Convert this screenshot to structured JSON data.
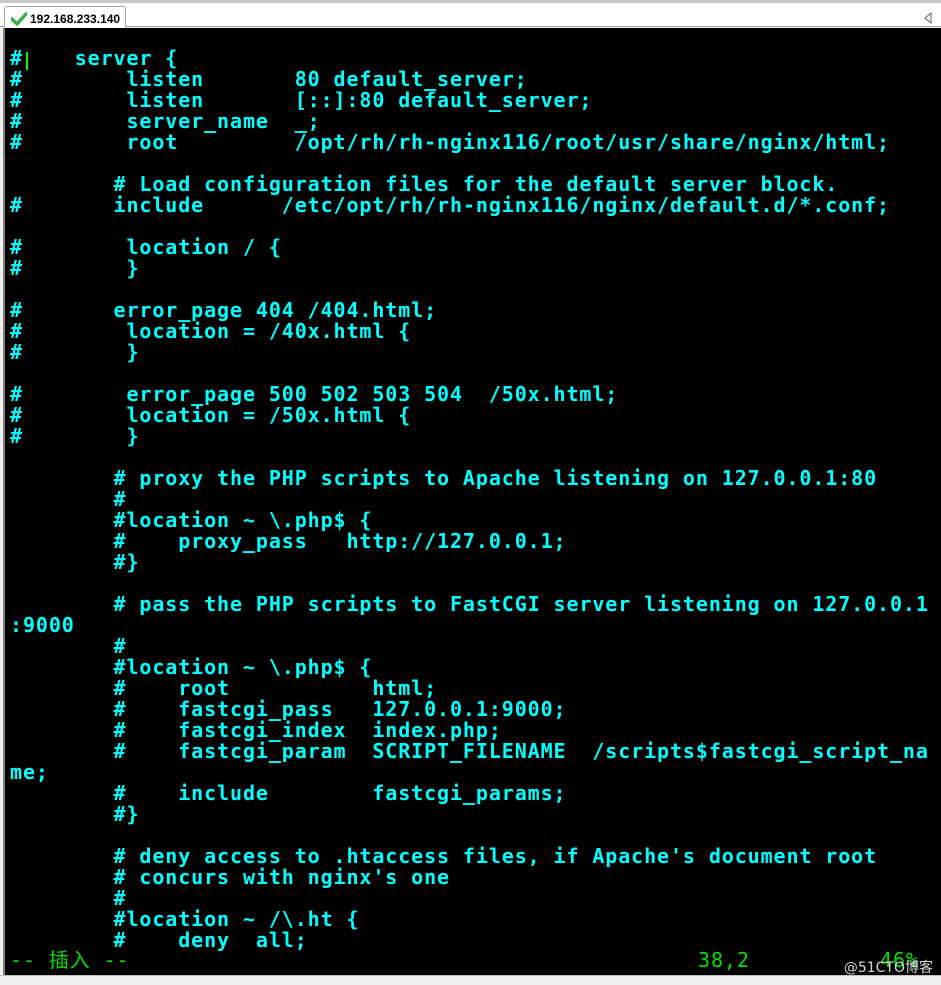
{
  "tab": {
    "title": "192.168.233.140",
    "status_icon": "check-icon",
    "status_color": "#3cb043"
  },
  "terminal": {
    "text_color": "#00ffff",
    "cursor_color": "#00ff00",
    "lines": [
      "#    server {",
      "#        listen       80 default_server;",
      "#        listen       [::]:80 default_server;",
      "#        server_name  _;",
      "#        root         /opt/rh/rh-nginx116/root/usr/share/nginx/html;",
      "",
      "        # Load configuration files for the default server block.",
      "#       include      /etc/opt/rh/rh-nginx116/nginx/default.d/*.conf;",
      "",
      "#        location / {",
      "#        }",
      "",
      "#       error_page 404 /404.html;",
      "#        location = /40x.html {",
      "#        }",
      "",
      "#        error_page 500 502 503 504  /50x.html;",
      "#        location = /50x.html {",
      "#        }",
      "",
      "        # proxy the PHP scripts to Apache listening on 127.0.0.1:80",
      "        #",
      "        #location ~ \\.php$ {",
      "        #    proxy_pass   http://127.0.0.1;",
      "        #}",
      "",
      "        # pass the PHP scripts to FastCGI server listening on 127.0.0.1",
      ":9000",
      "        #",
      "        #location ~ \\.php$ {",
      "        #    root           html;",
      "        #    fastcgi_pass   127.0.0.1:9000;",
      "        #    fastcgi_index  index.php;",
      "        #    fastcgi_param  SCRIPT_FILENAME  /scripts$fastcgi_script_na",
      "me;",
      "        #    include        fastcgi_params;",
      "        #}",
      "",
      "        # deny access to .htaccess files, if Apache's document root",
      "        # concurs with nginx's one",
      "        #",
      "        #location ~ /\\.ht {",
      "        #    deny  all;"
    ]
  },
  "status": {
    "mode": "-- 插入 --",
    "position": "38,2",
    "percent": "46%",
    "color": "#00e000"
  },
  "watermark": "@51CTO博客"
}
